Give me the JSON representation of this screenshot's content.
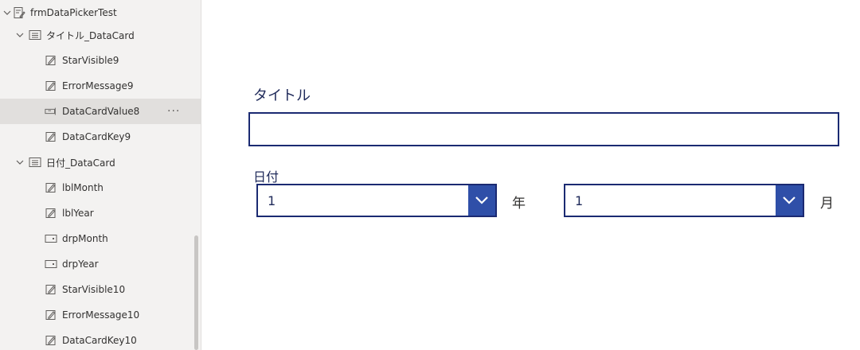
{
  "tree": {
    "items": [
      {
        "label": "frmDataPickerTest",
        "icon": "form-icon",
        "expanded": true
      },
      {
        "label": "タイトル_DataCard",
        "icon": "datacard-icon",
        "expanded": true
      },
      {
        "label": "StarVisible9",
        "icon": "label-edit-icon"
      },
      {
        "label": "ErrorMessage9",
        "icon": "label-edit-icon"
      },
      {
        "label": "DataCardValue8",
        "icon": "textinput-icon",
        "selected": true,
        "more": "···"
      },
      {
        "label": "DataCardKey9",
        "icon": "label-edit-icon"
      },
      {
        "label": "日付_DataCard",
        "icon": "datacard-icon",
        "expanded": true
      },
      {
        "label": "lblMonth",
        "icon": "label-edit-icon"
      },
      {
        "label": "lblYear",
        "icon": "label-edit-icon"
      },
      {
        "label": "drpMonth",
        "icon": "dropdown-control-icon"
      },
      {
        "label": "drpYear",
        "icon": "dropdown-control-icon"
      },
      {
        "label": "StarVisible10",
        "icon": "label-edit-icon"
      },
      {
        "label": "ErrorMessage10",
        "icon": "label-edit-icon"
      },
      {
        "label": "DataCardKey10",
        "icon": "label-edit-icon"
      }
    ]
  },
  "form": {
    "title_label": "タイトル",
    "title_value": "",
    "date_label": "日付",
    "year_dropdown": {
      "value": "1",
      "unit": "年"
    },
    "month_dropdown": {
      "value": "1",
      "unit": "月"
    }
  },
  "colors": {
    "accent": "#2f4fa8",
    "border": "#1b2a72",
    "text": "#1f2a5a"
  }
}
